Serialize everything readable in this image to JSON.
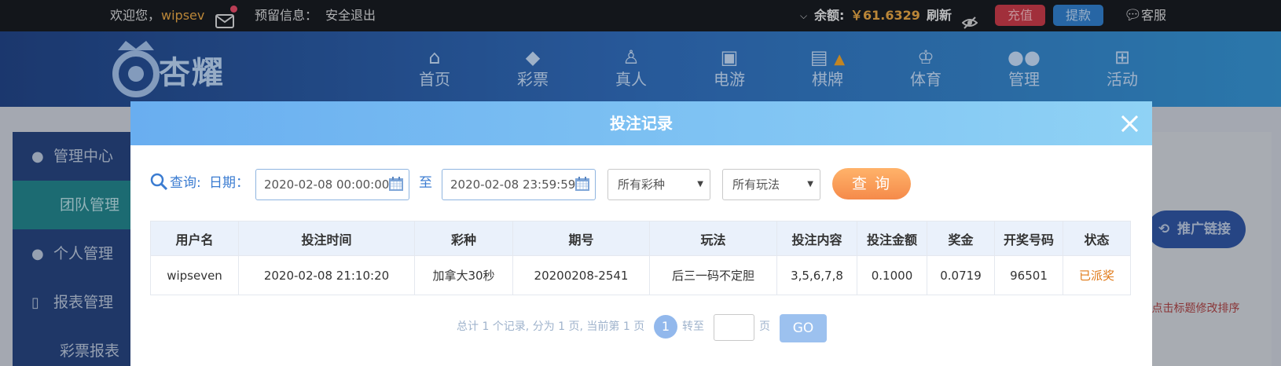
{
  "topbar": {
    "welcome": "欢迎您，",
    "username": "wipsev",
    "reserved_info": "预留信息：",
    "logout": "安全退出",
    "balance_label": "余额:",
    "balance_value": "￥61.6329",
    "refresh": "刷新",
    "recharge": "充值",
    "withdraw": "提款",
    "service": "客服"
  },
  "logo": {
    "text": "杏耀"
  },
  "nav": {
    "items": [
      {
        "label": "首页",
        "icon": "home-icon"
      },
      {
        "label": "彩票",
        "icon": "lottery-icon"
      },
      {
        "label": "真人",
        "icon": "live-dealer-icon"
      },
      {
        "label": "电游",
        "icon": "arcade-icon"
      },
      {
        "label": "棋牌",
        "icon": "cards-icon"
      },
      {
        "label": "体育",
        "icon": "trophy-icon"
      },
      {
        "label": "管理",
        "icon": "users-icon"
      },
      {
        "label": "活动",
        "icon": "gift-icon"
      }
    ]
  },
  "sidebar": {
    "items": [
      {
        "label": "管理中心",
        "icon": "users-icon"
      },
      {
        "label": "团队管理"
      },
      {
        "label": "个人管理",
        "icon": "person-icon"
      },
      {
        "label": "报表管理",
        "icon": "report-icon"
      },
      {
        "label": "彩票报表"
      }
    ]
  },
  "page": {
    "promo_button": "推广链接",
    "sort_note": "[点击标题修改排序"
  },
  "modal": {
    "title": "投注记录",
    "query_label": "查询:",
    "date_label": "日期：",
    "date_from": "2020-02-08 00:00:00",
    "to_label": "至",
    "date_to": "2020-02-08 23:59:59",
    "lottery_select": "所有彩种",
    "play_select": "所有玩法",
    "query_button": "查 询",
    "columns": [
      "用户名",
      "投注时间",
      "彩种",
      "期号",
      "玩法",
      "投注内容",
      "投注金额",
      "奖金",
      "开奖号码",
      "状态"
    ],
    "rows": [
      [
        "wipseven",
        "2020-02-08 21:10:20",
        "加拿大30秒",
        "20200208-2541",
        "后三一码不定胆",
        "3,5,6,7,8",
        "0.1000",
        "0.0719",
        "96501",
        "已派奖"
      ]
    ],
    "pager": {
      "summary": "总计 1 个记录, 分为 1 页, 当前第 1 页",
      "current_page": "1",
      "goto_label": "转至",
      "page_label": "页",
      "go_button": "GO"
    }
  },
  "colors": {
    "accent_blue": "#3b7cd1",
    "status_orange": "#e07a19",
    "query_button": "#f58a4a"
  }
}
